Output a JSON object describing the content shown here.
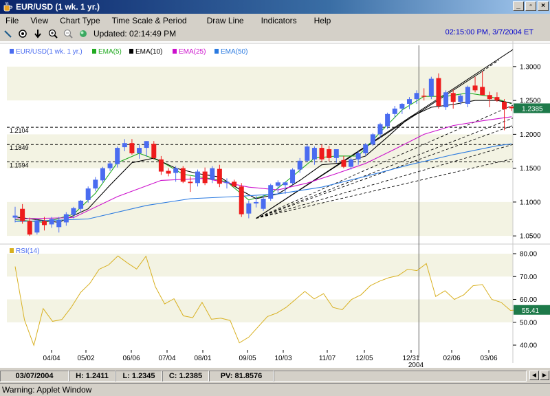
{
  "window": {
    "title": "EUR/USD (1 wk.  1 yr.)"
  },
  "window_buttons": [
    "_",
    "▫",
    "×"
  ],
  "menu": [
    "File",
    "View",
    "Chart Type",
    "Time Scale & Period",
    "Draw Line",
    "Indicators",
    "Help"
  ],
  "toolbar": {
    "tools": [
      "line-draw-icon",
      "crosshair-icon",
      "down-arrow-icon",
      "zoom-in-icon",
      "zoom-out-icon",
      "refresh-icon"
    ],
    "updated": "Updated: 02:14:49 PM",
    "clock": "02:15:00 PM, 3/7/2004 ET"
  },
  "colors": {
    "up": "#4a6cf0",
    "down": "#ee1c1c",
    "ema5": "#22aa22",
    "ema10": "#000000",
    "ema25": "#cc10cc",
    "ema50": "#2a7ae0",
    "rsi": "#d8b020",
    "value_tag": "#1e7a4a"
  },
  "chart_data": [
    {
      "type": "candlestick",
      "legend": [
        "EUR/USD(1 wk.  1 yr.)",
        "EMA(5)",
        "EMA(10)",
        "EMA(25)",
        "EMA(50)"
      ],
      "y_ticks": [
        "1.3000",
        "1.2500",
        "1.2000",
        "1.1500",
        "1.1000",
        "1.0500"
      ],
      "ylim": [
        1.04,
        1.31
      ],
      "current_value": "1.2385",
      "levels": [
        {
          "label": "1.2104",
          "value": 1.2104
        },
        {
          "label": "1.1849",
          "value": 1.1849
        },
        {
          "label": "1.1594",
          "value": 1.1594
        }
      ],
      "candles": [
        [
          1.077,
          1.093,
          1.07,
          1.08
        ],
        [
          1.09,
          1.097,
          1.068,
          1.072
        ],
        [
          1.072,
          1.077,
          1.05,
          1.052
        ],
        [
          1.055,
          1.075,
          1.052,
          1.073
        ],
        [
          1.072,
          1.078,
          1.058,
          1.066
        ],
        [
          1.067,
          1.078,
          1.062,
          1.075
        ],
        [
          1.063,
          1.078,
          1.055,
          1.073
        ],
        [
          1.07,
          1.085,
          1.065,
          1.082
        ],
        [
          1.081,
          1.093,
          1.076,
          1.091
        ],
        [
          1.09,
          1.103,
          1.085,
          1.102
        ],
        [
          1.103,
          1.123,
          1.099,
          1.12
        ],
        [
          1.12,
          1.137,
          1.116,
          1.133
        ],
        [
          1.132,
          1.152,
          1.128,
          1.15
        ],
        [
          1.15,
          1.16,
          1.146,
          1.157
        ],
        [
          1.156,
          1.182,
          1.151,
          1.18
        ],
        [
          1.181,
          1.193,
          1.175,
          1.187
        ],
        [
          1.187,
          1.193,
          1.17,
          1.172
        ],
        [
          1.172,
          1.185,
          1.164,
          1.18
        ],
        [
          1.18,
          1.19,
          1.167,
          1.19
        ],
        [
          1.186,
          1.19,
          1.163,
          1.165
        ],
        [
          1.163,
          1.168,
          1.14,
          1.145
        ],
        [
          1.146,
          1.15,
          1.138,
          1.142
        ],
        [
          1.143,
          1.153,
          1.13,
          1.15
        ],
        [
          1.15,
          1.153,
          1.128,
          1.13
        ],
        [
          1.13,
          1.138,
          1.115,
          1.128
        ],
        [
          1.128,
          1.148,
          1.123,
          1.145
        ],
        [
          1.145,
          1.151,
          1.125,
          1.128
        ],
        [
          1.133,
          1.153,
          1.128,
          1.15
        ],
        [
          1.149,
          1.155,
          1.122,
          1.127
        ],
        [
          1.128,
          1.135,
          1.12,
          1.13
        ],
        [
          1.13,
          1.133,
          1.122,
          1.123
        ],
        [
          1.123,
          1.128,
          1.078,
          1.082
        ],
        [
          1.083,
          1.102,
          1.076,
          1.098
        ],
        [
          1.098,
          1.109,
          1.092,
          1.1
        ],
        [
          1.09,
          1.11,
          1.087,
          1.105
        ],
        [
          1.105,
          1.127,
          1.102,
          1.125
        ],
        [
          1.124,
          1.132,
          1.112,
          1.129
        ],
        [
          1.125,
          1.13,
          1.112,
          1.129
        ],
        [
          1.128,
          1.15,
          1.126,
          1.148
        ],
        [
          1.148,
          1.165,
          1.143,
          1.161
        ],
        [
          1.161,
          1.185,
          1.159,
          1.182
        ],
        [
          1.163,
          1.182,
          1.155,
          1.18
        ],
        [
          1.18,
          1.185,
          1.16,
          1.163
        ],
        [
          1.178,
          1.183,
          1.16,
          1.165
        ],
        [
          1.165,
          1.178,
          1.158,
          1.178
        ],
        [
          1.162,
          1.168,
          1.15,
          1.152
        ],
        [
          1.152,
          1.165,
          1.148,
          1.163
        ],
        [
          1.163,
          1.175,
          1.155,
          1.172
        ],
        [
          1.172,
          1.187,
          1.168,
          1.185
        ],
        [
          1.185,
          1.202,
          1.183,
          1.2
        ],
        [
          1.2,
          1.217,
          1.195,
          1.215
        ],
        [
          1.212,
          1.232,
          1.208,
          1.23
        ],
        [
          1.23,
          1.242,
          1.224,
          1.238
        ],
        [
          1.238,
          1.246,
          1.23,
          1.245
        ],
        [
          1.245,
          1.255,
          1.237,
          1.252
        ],
        [
          1.252,
          1.265,
          1.245,
          1.261
        ],
        [
          1.257,
          1.268,
          1.25,
          1.256
        ],
        [
          1.256,
          1.285,
          1.252,
          1.282
        ],
        [
          1.283,
          1.29,
          1.238,
          1.242
        ],
        [
          1.24,
          1.265,
          1.236,
          1.262
        ],
        [
          1.261,
          1.266,
          1.238,
          1.248
        ],
        [
          1.248,
          1.26,
          1.244,
          1.257
        ],
        [
          1.245,
          1.272,
          1.24,
          1.27
        ],
        [
          1.272,
          1.285,
          1.262,
          1.265
        ],
        [
          1.27,
          1.293,
          1.265,
          1.258
        ],
        [
          1.258,
          1.263,
          1.24,
          1.252
        ],
        [
          1.255,
          1.262,
          1.248,
          1.25
        ],
        [
          1.248,
          1.252,
          1.206,
          1.237
        ],
        [
          1.2411,
          1.2411,
          1.2345,
          1.2385
        ]
      ],
      "emas": [
        {
          "name": "EMA(5)",
          "color_key": "ema5",
          "values": [
            [
              0,
              1.074
            ],
            [
              4,
              1.07
            ],
            [
              8,
              1.082
            ],
            [
              11,
              1.113
            ],
            [
              14,
              1.158
            ],
            [
              17,
              1.172
            ],
            [
              20,
              1.16
            ],
            [
              23,
              1.141
            ],
            [
              26,
              1.136
            ],
            [
              29,
              1.13
            ],
            [
              32,
              1.103
            ],
            [
              35,
              1.112
            ],
            [
              38,
              1.138
            ],
            [
              41,
              1.165
            ],
            [
              44,
              1.168
            ],
            [
              47,
              1.168
            ],
            [
              50,
              1.203
            ],
            [
              53,
              1.236
            ],
            [
              56,
              1.256
            ],
            [
              59,
              1.256
            ],
            [
              62,
              1.261
            ],
            [
              65,
              1.256
            ],
            [
              68,
              1.245
            ]
          ]
        },
        {
          "name": "EMA(10)",
          "color_key": "ema10",
          "values": [
            [
              0,
              1.078
            ],
            [
              6,
              1.07
            ],
            [
              10,
              1.09
            ],
            [
              13,
              1.125
            ],
            [
              16,
              1.158
            ],
            [
              19,
              1.165
            ],
            [
              22,
              1.15
            ],
            [
              25,
              1.142
            ],
            [
              28,
              1.137
            ],
            [
              31,
              1.117
            ],
            [
              33,
              1.105
            ],
            [
              36,
              1.112
            ],
            [
              39,
              1.132
            ],
            [
              42,
              1.155
            ],
            [
              45,
              1.158
            ],
            [
              48,
              1.168
            ],
            [
              51,
              1.196
            ],
            [
              54,
              1.225
            ],
            [
              57,
              1.24
            ],
            [
              60,
              1.244
            ],
            [
              63,
              1.25
            ],
            [
              66,
              1.25
            ],
            [
              68,
              1.246
            ]
          ]
        },
        {
          "name": "EMA(25)",
          "color_key": "ema25",
          "values": [
            [
              0,
              1.075
            ],
            [
              8,
              1.077
            ],
            [
              14,
              1.108
            ],
            [
              20,
              1.132
            ],
            [
              26,
              1.135
            ],
            [
              32,
              1.122
            ],
            [
              36,
              1.118
            ],
            [
              40,
              1.128
            ],
            [
              44,
              1.142
            ],
            [
              48,
              1.157
            ],
            [
              52,
              1.178
            ],
            [
              56,
              1.2
            ],
            [
              60,
              1.213
            ],
            [
              64,
              1.22
            ],
            [
              68,
              1.226
            ]
          ]
        },
        {
          "name": "EMA(50)",
          "color_key": "ema50",
          "values": [
            [
              0,
              1.071
            ],
            [
              10,
              1.075
            ],
            [
              18,
              1.095
            ],
            [
              24,
              1.105
            ],
            [
              30,
              1.108
            ],
            [
              36,
              1.112
            ],
            [
              42,
              1.122
            ],
            [
              48,
              1.138
            ],
            [
              54,
              1.155
            ],
            [
              60,
              1.17
            ],
            [
              66,
              1.183
            ],
            [
              68,
              1.186
            ]
          ]
        }
      ]
    },
    {
      "type": "line",
      "legend": [
        "RSI(14)"
      ],
      "y_ticks": [
        "80.00",
        "70.00",
        "60.00",
        "50.00",
        "40.00"
      ],
      "ylim": [
        40,
        80
      ],
      "current_value": "55.41",
      "values": [
        [
          0,
          74.4
        ],
        [
          1,
          51
        ],
        [
          2,
          39.9
        ],
        [
          3,
          56
        ],
        [
          4,
          50.4
        ],
        [
          5,
          51.2
        ],
        [
          6,
          56.5
        ],
        [
          7,
          63
        ],
        [
          8,
          67
        ],
        [
          9,
          73.2
        ],
        [
          10,
          75.1
        ],
        [
          11,
          79
        ],
        [
          12,
          76
        ],
        [
          13,
          73.3
        ],
        [
          14,
          78.9
        ],
        [
          15,
          65.6
        ],
        [
          16,
          58
        ],
        [
          17,
          60.3
        ],
        [
          18,
          52.8
        ],
        [
          19,
          52
        ],
        [
          20,
          58.7
        ],
        [
          21,
          51.3
        ],
        [
          22,
          51.8
        ],
        [
          23,
          50.8
        ],
        [
          24,
          41
        ],
        [
          25,
          43.5
        ],
        [
          26,
          48
        ],
        [
          27,
          52.5
        ],
        [
          28,
          54
        ],
        [
          29,
          56.5
        ],
        [
          30,
          60
        ],
        [
          31,
          63.5
        ],
        [
          32,
          60.2
        ],
        [
          33,
          62.5
        ],
        [
          34,
          56.5
        ],
        [
          35,
          55.5
        ],
        [
          36,
          60
        ],
        [
          37,
          62
        ],
        [
          38,
          66
        ],
        [
          39,
          68
        ],
        [
          40,
          69.5
        ],
        [
          41,
          70.4
        ],
        [
          42,
          73.2
        ],
        [
          43,
          72.6
        ],
        [
          44,
          75.7
        ],
        [
          45,
          61.3
        ],
        [
          46,
          63.8
        ],
        [
          47,
          60
        ],
        [
          48,
          62
        ],
        [
          49,
          66
        ],
        [
          50,
          66.5
        ],
        [
          51,
          60
        ],
        [
          52,
          58.7
        ],
        [
          53,
          55.2
        ],
        [
          54,
          55.5
        ]
      ]
    }
  ],
  "x_labels": [
    "04/04",
    "05/02",
    "06/06",
    "07/04",
    "08/01",
    "09/05",
    "10/03",
    "11/07",
    "12/05",
    "12/31",
    "02/06",
    "03/06"
  ],
  "x_year": "2004",
  "status": {
    "date": "03/07/2004",
    "high": "H: 1.2411",
    "low": "L: 1.2345",
    "close": "C: 1.2385",
    "pv": "PV: 81.8576"
  },
  "warning": "Warning: Applet Window"
}
